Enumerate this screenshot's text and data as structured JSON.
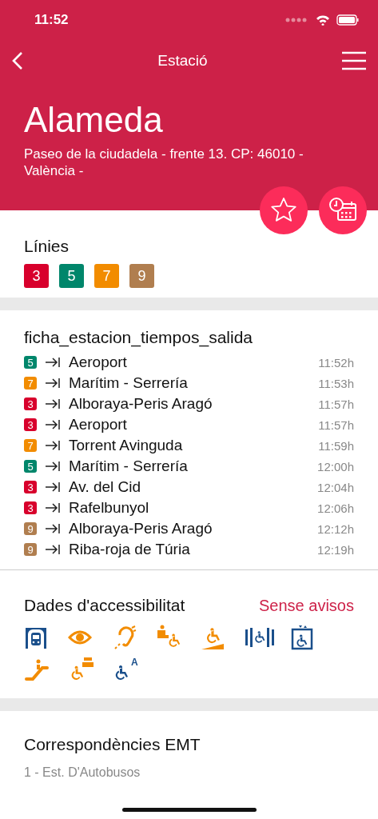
{
  "status_bar": {
    "time": "11:52"
  },
  "nav": {
    "title": "Estació"
  },
  "station": {
    "name": "Alameda",
    "address": "Paseo de la ciudadela - frente 13. CP: 46010 - València -"
  },
  "lines": {
    "title": "Línies",
    "items": [
      {
        "label": "3",
        "color": "#d8002c"
      },
      {
        "label": "5",
        "color": "#00866b"
      },
      {
        "label": "7",
        "color": "#f28c00"
      },
      {
        "label": "9",
        "color": "#b07e4f"
      }
    ]
  },
  "departures": {
    "title": "ficha_estacion_tiempos_salida",
    "rows": [
      {
        "line": "5",
        "color": "#00866b",
        "destination": "Aeroport",
        "time": "11:52h"
      },
      {
        "line": "7",
        "color": "#f28c00",
        "destination": "Marítim - Serrería",
        "time": "11:53h"
      },
      {
        "line": "3",
        "color": "#d8002c",
        "destination": "Alboraya-Peris Aragó",
        "time": "11:57h"
      },
      {
        "line": "3",
        "color": "#d8002c",
        "destination": "Aeroport",
        "time": "11:57h"
      },
      {
        "line": "7",
        "color": "#f28c00",
        "destination": "Torrent Avinguda",
        "time": "11:59h"
      },
      {
        "line": "5",
        "color": "#00866b",
        "destination": "Marítim - Serrería",
        "time": "12:00h"
      },
      {
        "line": "3",
        "color": "#d8002c",
        "destination": "Av. del Cid",
        "time": "12:04h"
      },
      {
        "line": "3",
        "color": "#d8002c",
        "destination": "Rafelbunyol",
        "time": "12:06h"
      },
      {
        "line": "9",
        "color": "#b07e4f",
        "destination": "Alboraya-Peris Aragó",
        "time": "12:12h"
      },
      {
        "line": "9",
        "color": "#b07e4f",
        "destination": "Riba-roja de Túria",
        "time": "12:19h"
      }
    ]
  },
  "accessibility": {
    "title": "Dades d'accessibilitat",
    "notice": "Sense avisos",
    "icons": [
      {
        "kind": "train",
        "color": "#1a4f8b"
      },
      {
        "kind": "eye",
        "color": "#f28c00"
      },
      {
        "kind": "ear",
        "color": "#f28c00"
      },
      {
        "kind": "assist",
        "color": "#f28c00"
      },
      {
        "kind": "ramp",
        "color": "#f28c00"
      },
      {
        "kind": "gate",
        "color": "#1a4f8b"
      },
      {
        "kind": "lift",
        "color": "#1a4f8b"
      },
      {
        "kind": "escalator",
        "color": "#f28c00"
      },
      {
        "kind": "counter",
        "color": "#f28c00"
      },
      {
        "kind": "wheelchair",
        "color": "#1a4f8b",
        "badge": "A"
      }
    ]
  },
  "connections": {
    "title": "Correspondències EMT",
    "items": [
      "1 - Est. D'Autobusos"
    ]
  }
}
